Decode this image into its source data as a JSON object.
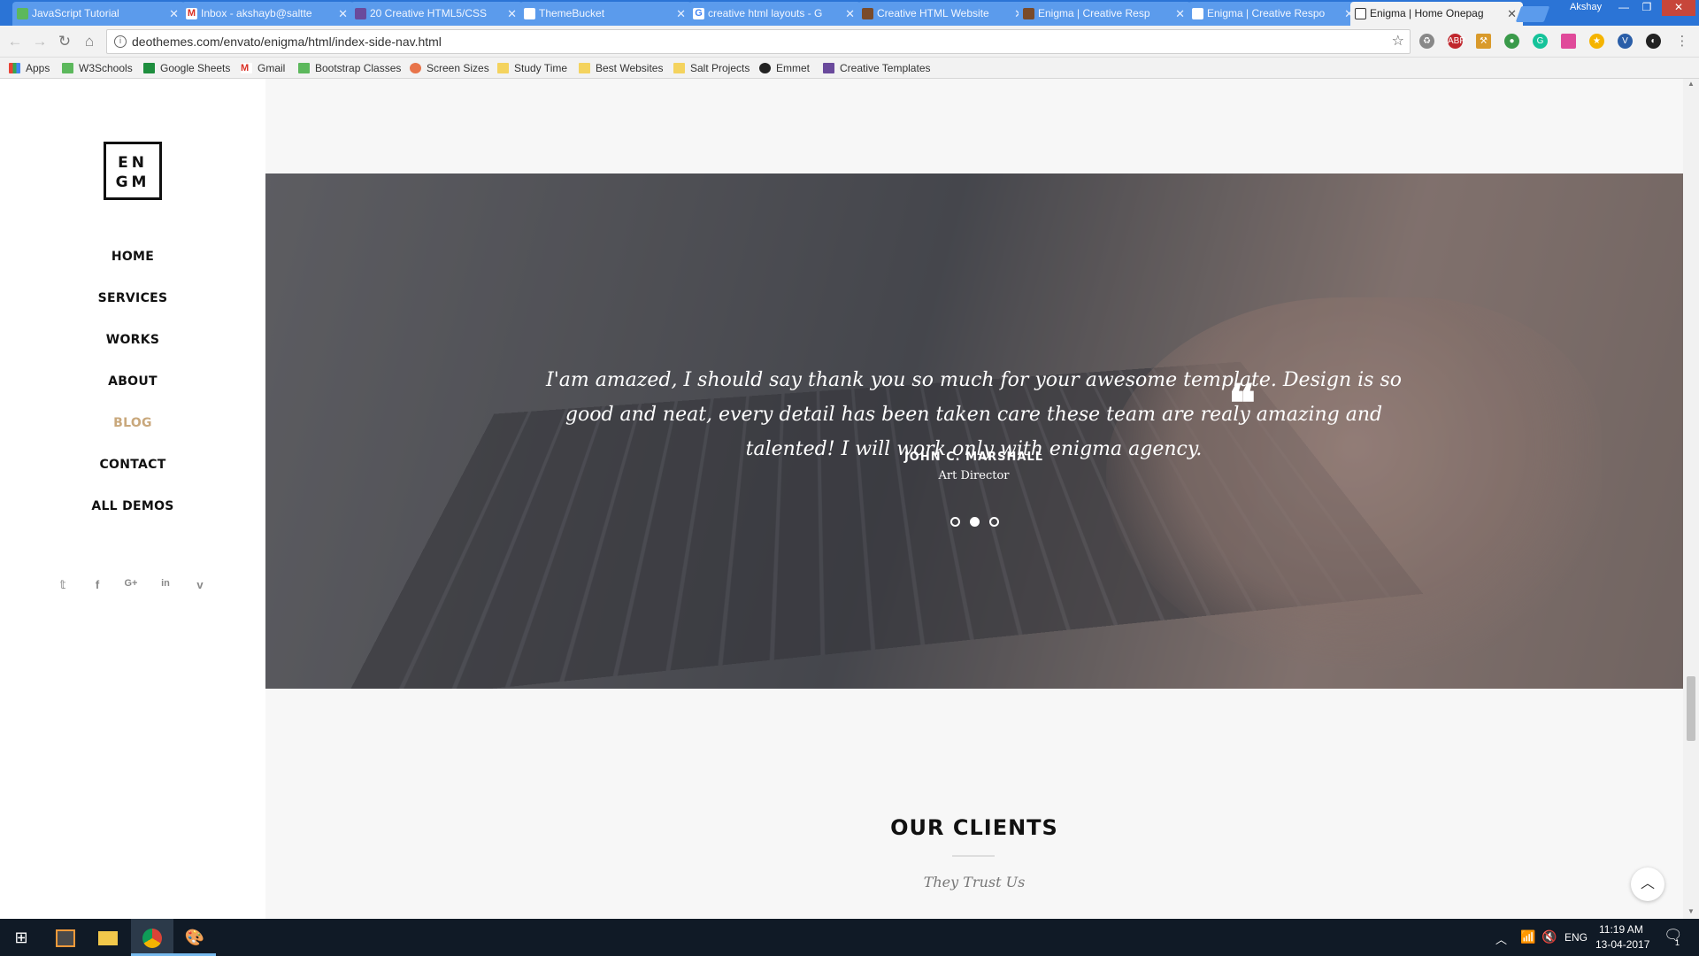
{
  "browser": {
    "tabs": [
      {
        "title": "JavaScript Tutorial",
        "icon": "w3schools-icon",
        "color": "#5cb85c"
      },
      {
        "title": "Inbox - akshayb@saltte",
        "icon": "gmail-icon",
        "color": "#d93025"
      },
      {
        "title": "20 Creative HTML5/CSS",
        "icon": "site-icon",
        "color": "#6a4a9c"
      },
      {
        "title": "ThemeBucket",
        "icon": "page-icon",
        "color": "#ffffff"
      },
      {
        "title": "creative html layouts - G",
        "icon": "google-icon",
        "color": "#ffffff"
      },
      {
        "title": "Creative HTML Website",
        "icon": "site-icon",
        "color": "#7a4b2a"
      },
      {
        "title": "Enigma | Creative Resp",
        "icon": "site-icon",
        "color": "#7a4b2a"
      },
      {
        "title": "Enigma | Creative Respo",
        "icon": "page-icon",
        "color": "#ffffff"
      },
      {
        "title": "Enigma | Home Onepag",
        "icon": "enigma-icon",
        "color": "#333333",
        "active": true
      }
    ],
    "user": "Akshay",
    "url": "deothemes.com/envato/enigma/html/index-side-nav.html"
  },
  "bookmarks": [
    {
      "label": "Apps",
      "icon": "apps-icon",
      "color": "#e94235"
    },
    {
      "label": "W3Schools",
      "icon": "w3schools-icon",
      "color": "#5cb85c"
    },
    {
      "label": "Google Sheets",
      "icon": "sheets-icon",
      "color": "#1e8e3e"
    },
    {
      "label": "Gmail",
      "icon": "gmail-icon",
      "color": "#d93025"
    },
    {
      "label": "Bootstrap Classes",
      "icon": "w3schools-icon",
      "color": "#5cb85c"
    },
    {
      "label": "Screen Sizes",
      "icon": "screensizes-icon",
      "color": "#e8744a"
    },
    {
      "label": "Study Time",
      "icon": "folder-icon",
      "color": "#f4d35e"
    },
    {
      "label": "Best Websites",
      "icon": "folder-icon",
      "color": "#f4d35e"
    },
    {
      "label": "Salt Projects",
      "icon": "folder-icon",
      "color": "#f4d35e"
    },
    {
      "label": "Emmet",
      "icon": "emmet-icon",
      "color": "#222222"
    },
    {
      "label": "Creative Templates",
      "icon": "site-icon",
      "color": "#6a4a9c"
    }
  ],
  "site": {
    "logo": {
      "line1": "EN",
      "line2": "GM"
    },
    "nav": [
      {
        "label": "HOME"
      },
      {
        "label": "SERVICES"
      },
      {
        "label": "WORKS"
      },
      {
        "label": "ABOUT"
      },
      {
        "label": "BLOG",
        "active": true
      },
      {
        "label": "CONTACT"
      },
      {
        "label": "ALL DEMOS"
      }
    ],
    "accent_color": "#c9a87c",
    "social": [
      "twitter-icon",
      "facebook-icon",
      "google-plus-icon",
      "linkedin-icon",
      "vimeo-icon"
    ],
    "testimonial": {
      "quote": "I'am amazed, I should say thank you so much for your awesome template. Design is so good and neat, every detail has been taken care these team are realy amazing and talented! I will work only with enigma agency.",
      "author": "JOHN C. MARSHALL",
      "role": "Art Director",
      "slide_count": 3,
      "active_slide": 2
    },
    "clients": {
      "title": "OUR CLIENTS",
      "subtitle": "They Trust Us"
    }
  },
  "taskbar": {
    "language": "ENG",
    "time": "11:19 AM",
    "date": "13-04-2017",
    "notification_count": "1"
  }
}
